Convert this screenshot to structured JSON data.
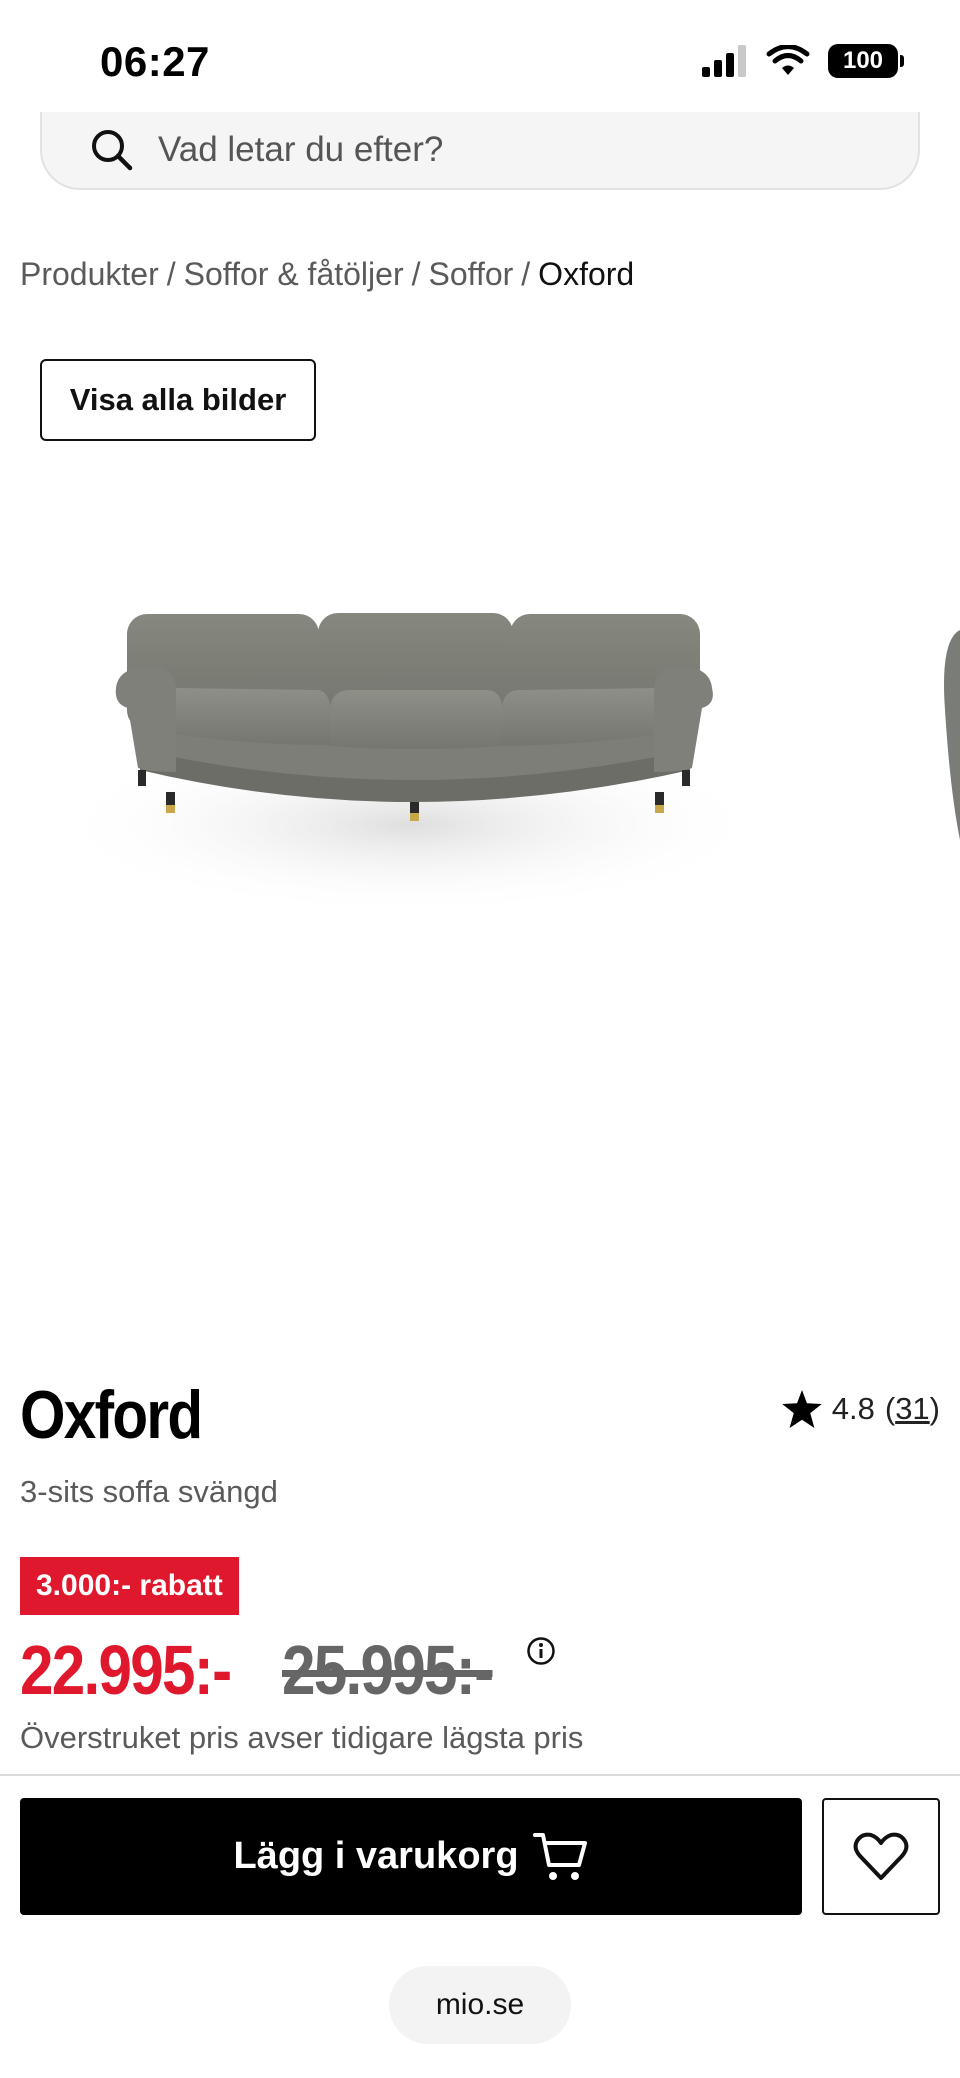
{
  "status_bar": {
    "time": "06:27",
    "battery": "100",
    "icons": [
      "signal-icon",
      "wifi-icon",
      "battery-icon"
    ]
  },
  "search": {
    "placeholder": "Vad letar du efter?",
    "icon": "search-icon"
  },
  "breadcrumb": {
    "items": [
      "Produkter",
      "Soffor & fåtöljer",
      "Soffor",
      "Oxford"
    ],
    "separator": "/"
  },
  "gallery": {
    "view_all_label": "Visa alla bilder"
  },
  "product": {
    "title": "Oxford",
    "subtitle": "3-sits soffa svängd",
    "rating": "4.8",
    "review_count": "31",
    "discount_badge": "3.000:- rabatt",
    "price_now": "22.995:-",
    "price_old": "25.995:-",
    "price_note": "Överstruket pris avser tidigare lägsta pris"
  },
  "actions": {
    "add_to_cart_label": "Lägg i varukorg",
    "cart_icon": "cart-icon",
    "wishlist_icon": "heart-icon"
  },
  "browser": {
    "url": "mio.se"
  },
  "colors": {
    "accent_red": "#e0182d",
    "button_black": "#000000",
    "text_gray": "#5a5a5a",
    "sofa_gray": "#7a7c77"
  }
}
